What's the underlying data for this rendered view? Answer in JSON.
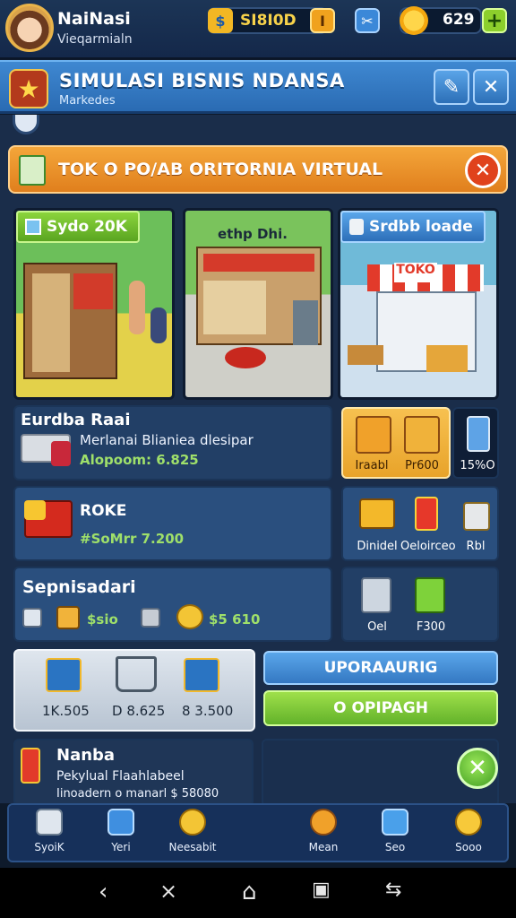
{
  "player": {
    "name": "NaiNasi",
    "subtitle": "Vieqarmialn"
  },
  "resources": {
    "cash": "SI8I0D",
    "cash_badge": "I",
    "gems": "629",
    "add": "+"
  },
  "header": {
    "title": "SIMULASI BISNIS NDANSA",
    "subtitle": "Markedes",
    "close": "✕"
  },
  "notice": {
    "text": "TOK O PO/AB ORITORNIA VIRTUAL",
    "close": "✕"
  },
  "shops": [
    {
      "label": "Sydo 20K"
    },
    {
      "label": "ethp Dhi."
    },
    {
      "label": "Srdbb loade"
    }
  ],
  "ranking": {
    "title": "Eurdba Raai",
    "desc": "Merlanai Blianiea dlesipar",
    "value": "Alopoom: 6.825"
  },
  "stock_cards": {
    "items": [
      "Iraabl",
      "Pr600"
    ],
    "side": "15%O"
  },
  "roke": {
    "title": "ROKE",
    "value": "#SoMrr 7.200"
  },
  "roke_side": {
    "items": [
      "Dinidel",
      "Oeloirceo",
      "Rbl"
    ]
  },
  "sepnis": {
    "title": "Sepnisadari",
    "value1": "$sio",
    "value2": "$5 610"
  },
  "sepnis_side": {
    "items": [
      "Oel",
      "F300"
    ]
  },
  "cart": {
    "prices": [
      "1K.505",
      "D 8.625",
      "8 3.500"
    ]
  },
  "buttons": {
    "upgrade": "UPORAAURIG",
    "green": "O OPIPAGH",
    "ok": "✕"
  },
  "nanba": {
    "title": "Nanba",
    "line1": "Pekylual Flaahlabeel",
    "line2": "Iinoadern o manarl $ 58080"
  },
  "nav": [
    "SyoiK",
    "Yeri",
    "Neesabit",
    "Mean",
    "Seo",
    "Sooo"
  ]
}
